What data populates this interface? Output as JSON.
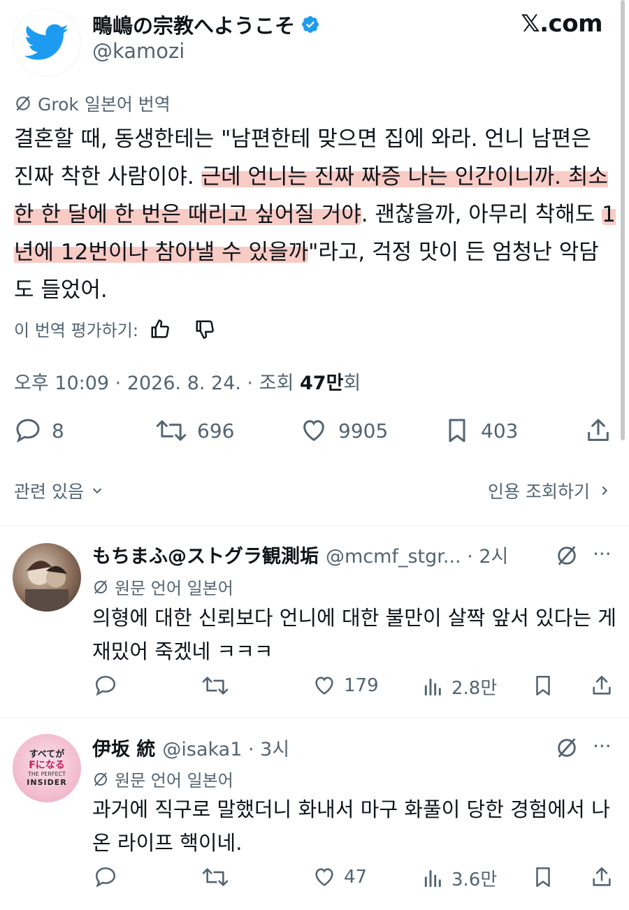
{
  "header": {
    "display_name": "鴫嶋の宗教へようこそ",
    "handle": "@kamozi",
    "site": "𝕏.com"
  },
  "tweet": {
    "grok_label": "Grok 일본어 번역",
    "text": {
      "p1": "결혼할 때, 동생한테는 \"남편한테 맞으면 집에 와라. 언니 남편은 진짜 착한 사람이야. ",
      "h1": "근데 언니는 진짜 짜증 나는 인간이니까. 최소한 한 달에 한 번은 때리고 싶어질 거야",
      "p2": ". 괜찮을까, 아무리 착해도 ",
      "h2": "1년에 12번이나 참아낼 수 있을까",
      "p3": "\"라고, 걱정 맛이 든 엄청난 악담도 들었어."
    },
    "rate_label": "이 번역 평가하기:",
    "timestamp": "오후 10:09 · 2026. 8. 24. · 조회 ",
    "views": "47만",
    "views_suffix": "회",
    "stats": {
      "replies": "8",
      "retweets": "696",
      "likes": "9905",
      "bookmarks": "403"
    },
    "related_label": "관련 있음",
    "quote_label": "인용 조회하기"
  },
  "replies": [
    {
      "name": "もちまふ@ストグラ観測垢",
      "handle": "@mcmf_stgr... · 2시",
      "lang_label": "원문 언어 일본어",
      "text": "의형에 대한 신뢰보다 언니에 대한 불만이 살짝 앞서 있다는 게 재밌어 죽겠네 ㅋㅋㅋ",
      "likes": "179",
      "views": "2.8만"
    },
    {
      "name": "伊坂 統",
      "handle": "@isaka1 · 3시",
      "lang_label": "원문 언어 일본어",
      "text": "과거에 직구로 말했더니 화내서 마구 화풀이 당한 경험에서 나온 라이프 핵이네.",
      "likes": "47",
      "views": "3.6만",
      "avatar_text": [
        "すべてが",
        "Fになる",
        "THE PERFECT",
        "INSIDER"
      ]
    }
  ],
  "colors": {
    "twitter_blue": "#1d9bf0",
    "highlight": "#f4a096",
    "text": "#0f1419",
    "secondary": "#536471"
  }
}
